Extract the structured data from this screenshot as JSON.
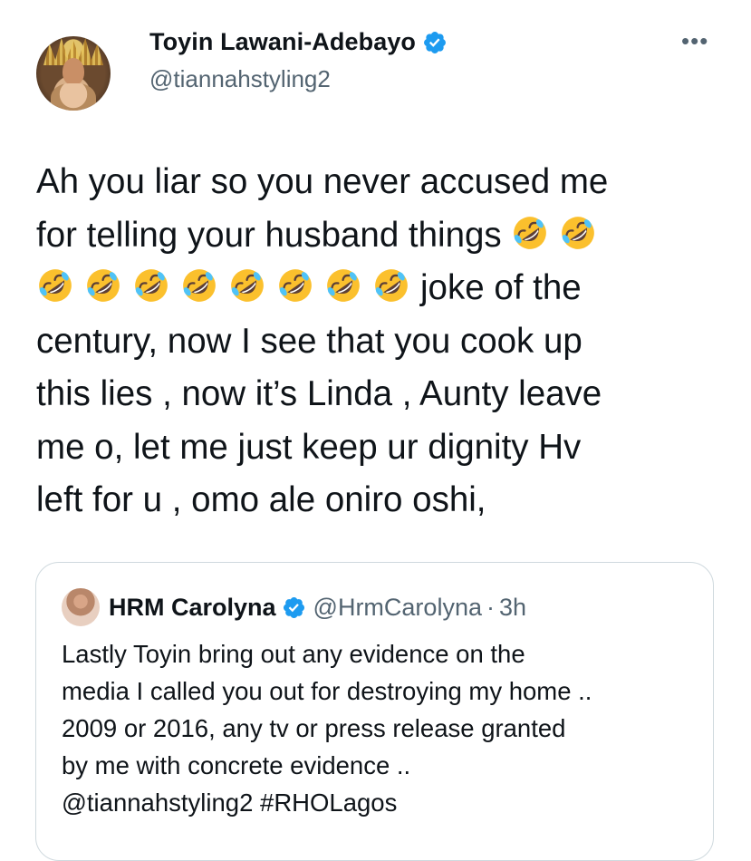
{
  "author": {
    "display_name": "Toyin Lawani-Adebayo",
    "handle": "@tiannahstyling2",
    "verified": true,
    "more_label": "•••"
  },
  "tweet": {
    "line1": "Ah you liar so you never accused me",
    "line2_text": "for telling your husband things ",
    "line3_text": "joke of the",
    "rest": "century, now I see that you cook up\nthis lies , now it’s Linda , Aunty leave\nme o, let me just keep ur dignity Hv\nleft for u , omo ale oniro oshi,",
    "emoji_name": "rolling-on-the-floor-laughing",
    "emoji_count_line2": 2,
    "emoji_count_line3": 8
  },
  "quoted": {
    "display_name": "HRM Carolyna",
    "handle": "@HrmCarolyna",
    "separator": "·",
    "time": "3h",
    "verified": true,
    "text": "Lastly Toyin bring out any evidence on the\nmedia I called you out for destroying my home ..\n2009 or 2016, any tv or press release granted\nby me with concrete evidence ..\n@tiannahstyling2 #RHOLagos"
  },
  "colors": {
    "verified_blue": "#1d9bf0",
    "secondary_text": "#536471",
    "primary_text": "#0f1419",
    "border": "#cfd9de",
    "emoji_yellow": "#fbc02d"
  }
}
